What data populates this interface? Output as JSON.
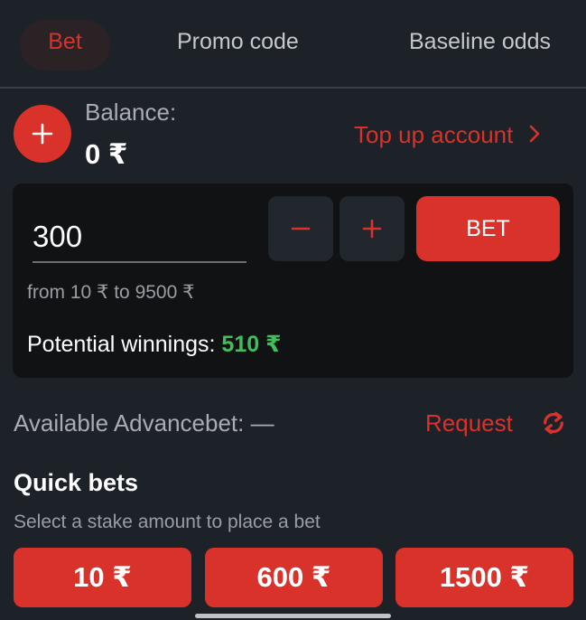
{
  "tabs": [
    {
      "label": "Bet",
      "active": true
    },
    {
      "label": "Promo code",
      "active": false
    },
    {
      "label": "Baseline odds",
      "active": false
    }
  ],
  "balance": {
    "label": "Balance:",
    "value": "0 ₹",
    "topup_label": "Top up account",
    "topup_icon": "chevron-right-icon",
    "add_icon": "plus-icon"
  },
  "stake": {
    "value": "300",
    "decrease_icon": "minus-icon",
    "increase_icon": "plus-icon",
    "bet_label": "BET",
    "range": "from 10 ₹ to 9500 ₹",
    "winnings_label": "Potential winnings:",
    "winnings_value": "510 ₹"
  },
  "advancebet": {
    "label": "Available Advancebet: —",
    "request_label": "Request",
    "request_icon": "refresh-icon"
  },
  "quick_bets": {
    "title": "Quick bets",
    "subtitle": "Select a stake amount to place a bet",
    "amounts": [
      "10 ₹",
      "600 ₹",
      "1500 ₹"
    ]
  },
  "colors": {
    "accent": "#d8322b",
    "background": "#1d2128",
    "card": "#111214",
    "positive": "#3fbf59"
  }
}
